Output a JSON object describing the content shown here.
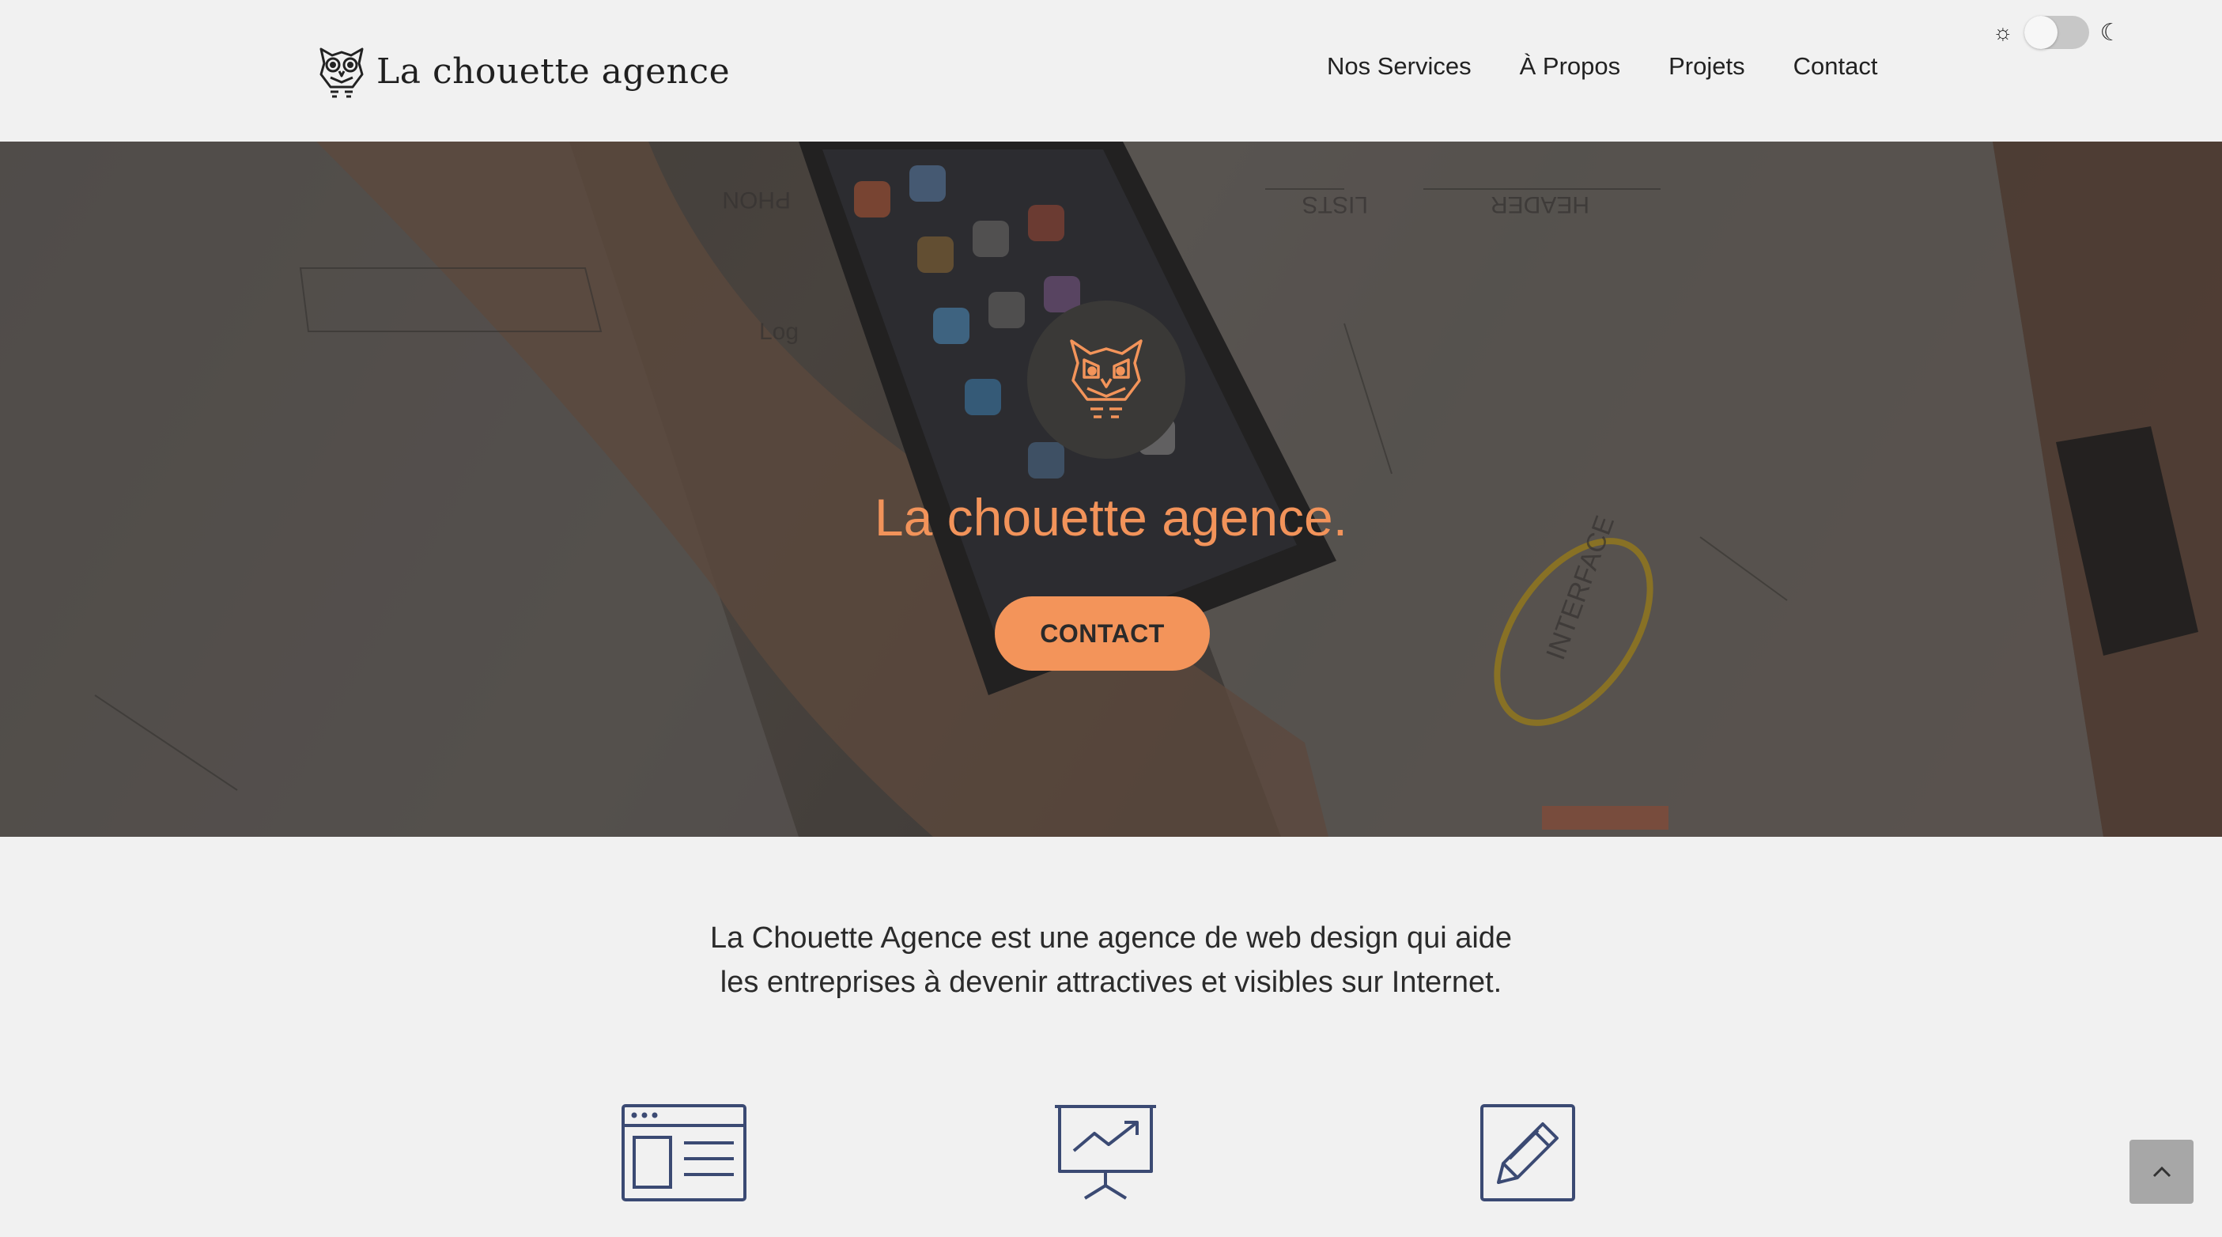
{
  "brand": {
    "name": "La chouette agence"
  },
  "nav": {
    "items": [
      "Nos Services",
      "À Propos",
      "Projets",
      "Contact"
    ]
  },
  "theme_toggle": {
    "sun_icon": "sun-icon",
    "moon_icon": "moon-icon",
    "dark_mode": false
  },
  "hero": {
    "title": "La chouette agence.",
    "cta_label": "CONTACT",
    "background_labels": [
      "PHON",
      "LISTS",
      "HEADER",
      "Log",
      "INTERFACE"
    ]
  },
  "intro": {
    "line1": "La Chouette Agence est une agence de web design qui aide",
    "line2": "les entreprises à devenir attractives et visibles sur Internet."
  },
  "services": {
    "icons": [
      "web-layout-icon",
      "presentation-chart-icon",
      "pencil-edit-icon"
    ]
  },
  "colors": {
    "accent": "#f3945a",
    "icon_navy": "#3b4a73",
    "background": "#f1f1f1"
  }
}
